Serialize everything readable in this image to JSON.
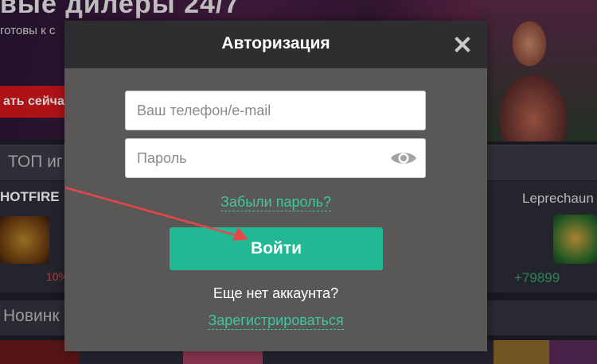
{
  "background": {
    "banner_title": "вые дилеры 24/7",
    "banner_subtitle": "готовы к с",
    "banner_button": "ать сейча",
    "section_top_title": "ТОП иг",
    "game_left_title": "HOTFIRE",
    "game_left_percent": "10%",
    "game_right_title": "Leprechaun",
    "game_right_value": "+79899",
    "section_new_title": "Новинк"
  },
  "modal": {
    "title": "Авторизация",
    "login_placeholder": "Ваш телефон/e-mail",
    "password_placeholder": "Пароль",
    "forgot_label": "Забыли пароль?",
    "submit_label": "Войти",
    "no_account_text": "Еще нет аккаунта?",
    "register_label": "Зарегистрироваться"
  },
  "colors": {
    "accent": "#23b894",
    "link": "#3fc6a2",
    "header": "#2e2d2f",
    "modal_body": "#5a5856",
    "annotation_arrow": "#e8474a"
  },
  "icons": {
    "close": "close-icon",
    "password_visibility": "eye-icon"
  }
}
